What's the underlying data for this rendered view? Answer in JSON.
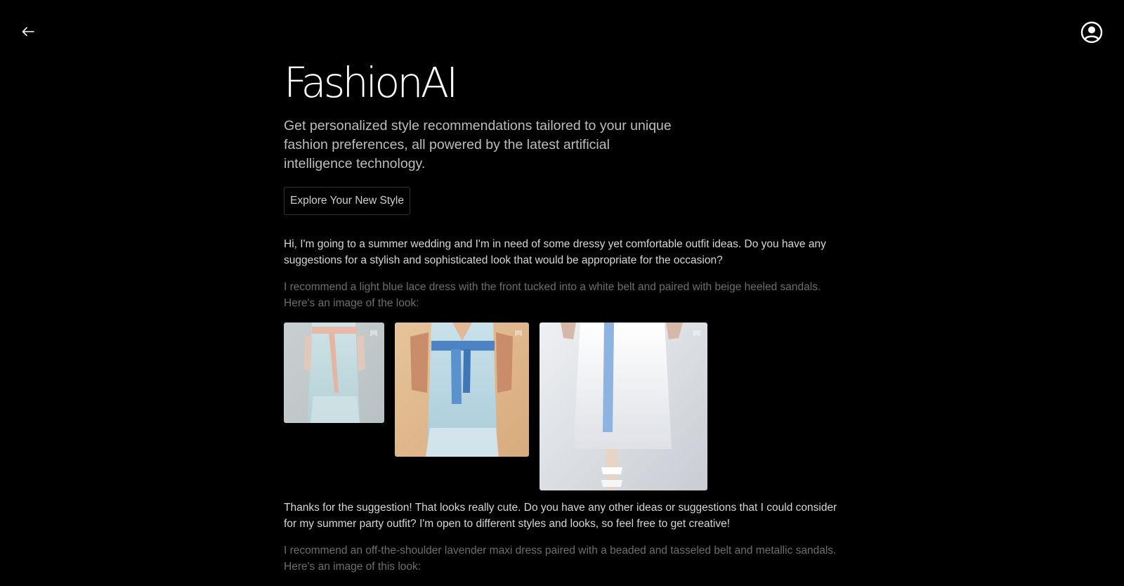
{
  "header": {
    "back_icon": "arrow-left-icon",
    "profile_icon": "user-circle-icon"
  },
  "hero": {
    "brand": "FashionAI",
    "tagline": "Get personalized style recommendations tailored to your unique fashion preferences, all powered by the latest artificial intelligence technology.",
    "cta_label": "Explore Your New Style"
  },
  "conversation": {
    "messages": [
      {
        "role": "user",
        "text": "Hi, I'm going to a summer wedding and I'm in need of some dressy yet comfortable outfit ideas. Do you have any suggestions for a stylish and sophisticated look that would be appropriate for the occasion?"
      },
      {
        "role": "assistant",
        "text": "I recommend a light blue lace dress with the front tucked into a white belt and paired with beige heeled sandals. Here's an image of the look:",
        "images": [
          {
            "subject": "light blue lace dress with peach ribbon belt",
            "save_icon": "bookmark-icon"
          },
          {
            "subject": "light blue dress with blue belt on tan background",
            "save_icon": "bookmark-icon"
          },
          {
            "subject": "white lace midi skirt with blue ribbon and white heeled sandals",
            "save_icon": "bookmark-icon"
          }
        ]
      },
      {
        "role": "user",
        "text": "Thanks for the suggestion! That looks really cute. Do you have any other ideas or suggestions that I could consider for my summer party outfit? I'm open to different styles and looks, so feel free to get creative!"
      },
      {
        "role": "assistant",
        "text": "I recommend an off-the-shoulder lavender maxi dress paired with a beaded and tasseled belt and metallic sandals. Here's an image of this look:"
      }
    ]
  },
  "colors": {
    "background": "#000000",
    "brand_text": "#ffffff",
    "user_text": "#d7d7d7",
    "assistant_text": "#6e6e6e"
  }
}
